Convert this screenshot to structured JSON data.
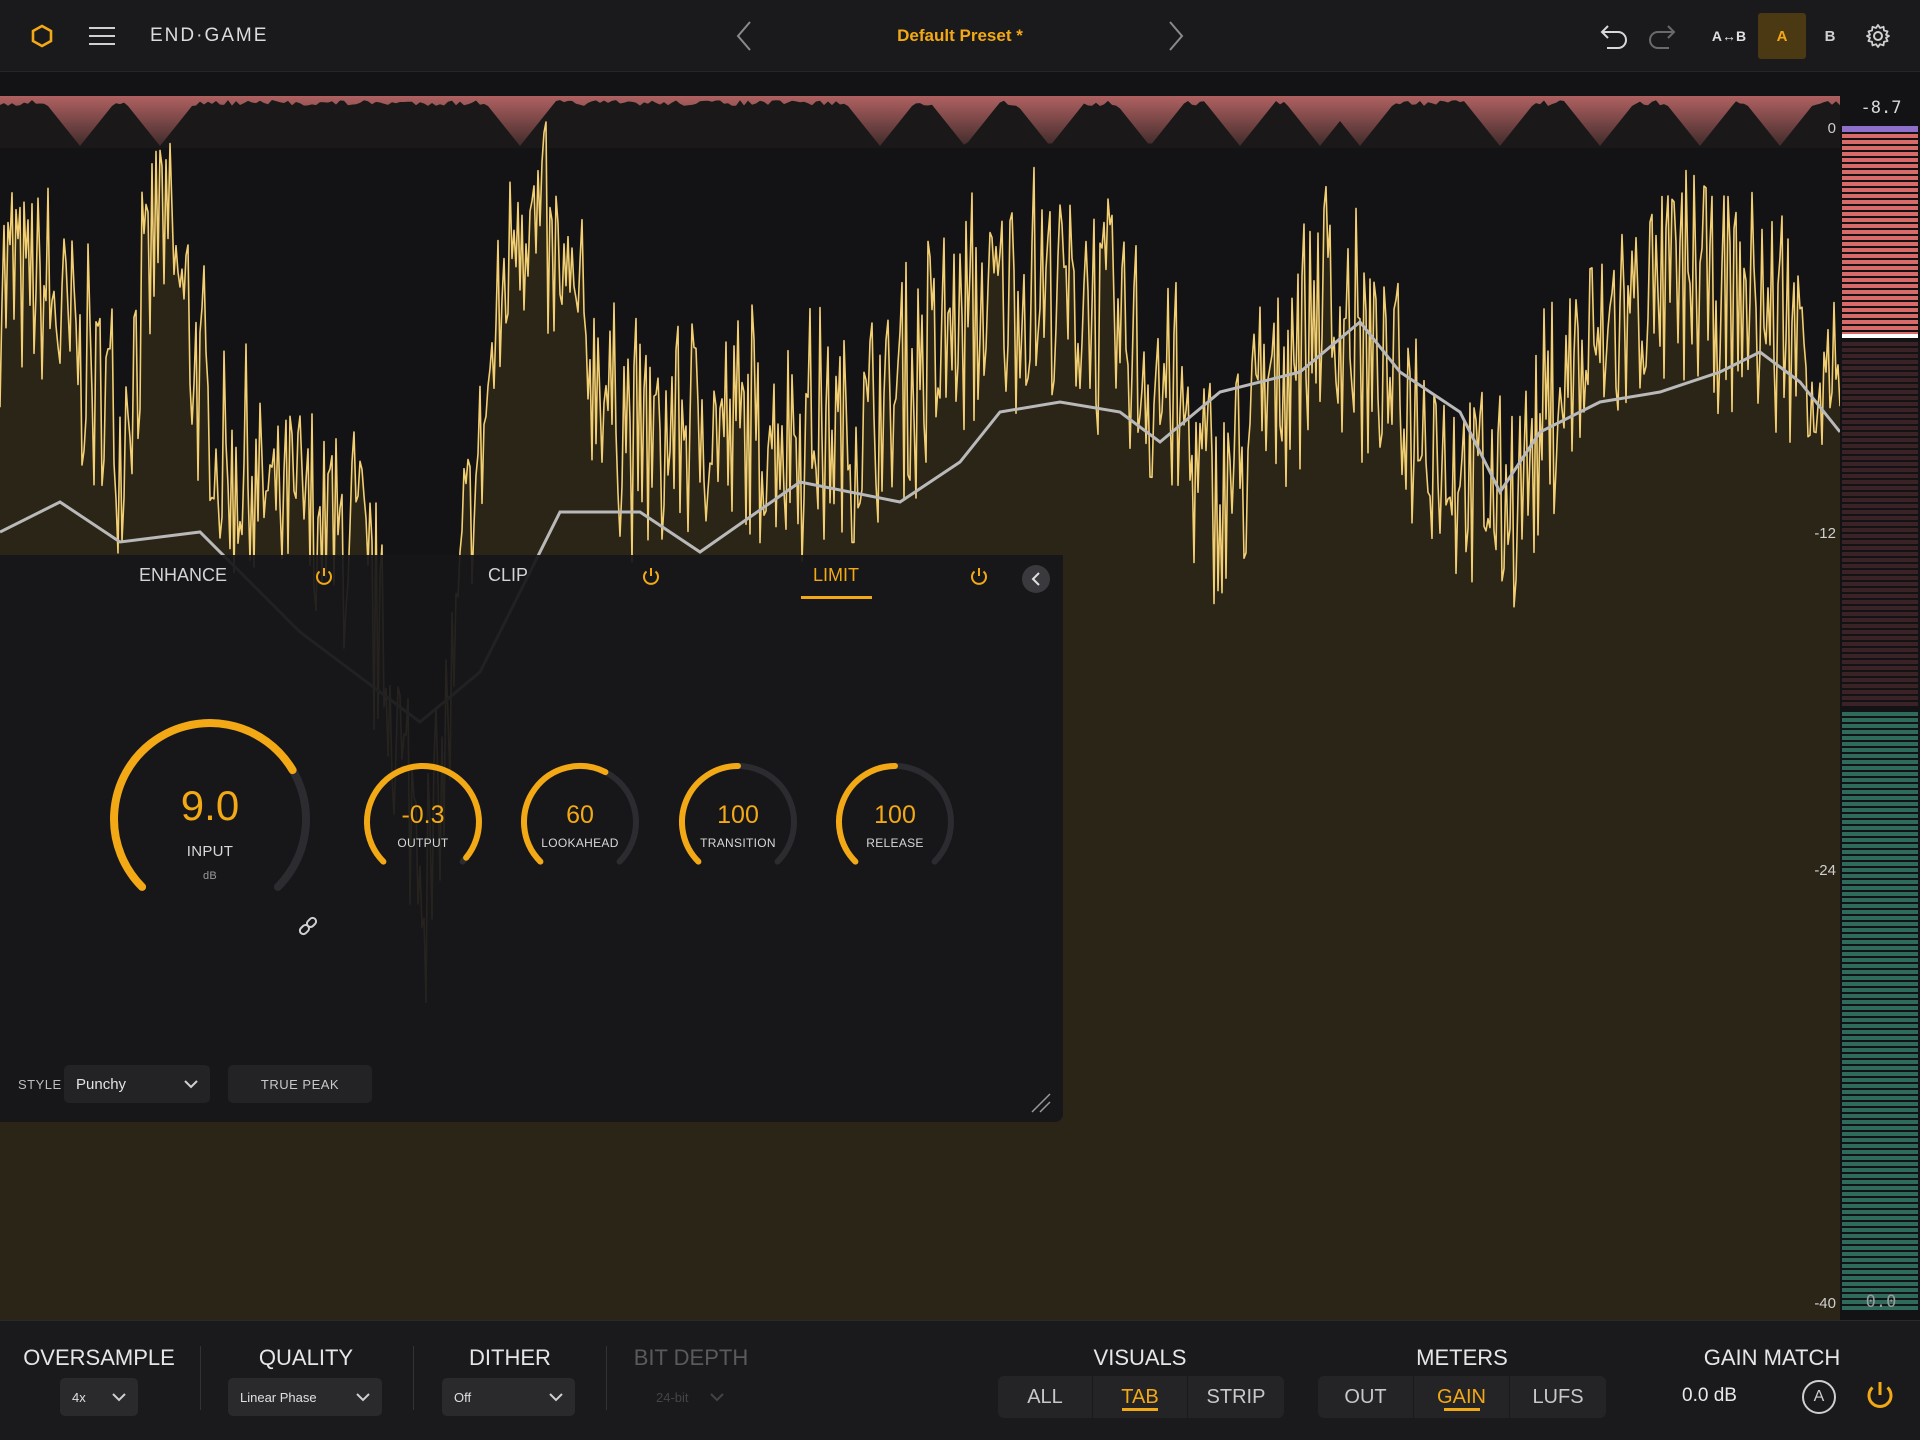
{
  "app": {
    "title": "END·GAME"
  },
  "header": {
    "preset": "Default Preset *",
    "ab_copy": "A↔B",
    "slot_a": "A",
    "slot_b": "B"
  },
  "icons": {
    "logo": "hexagon-icon",
    "menu": "hamburger-icon",
    "prev": "chevron-left-icon",
    "next": "chevron-right-icon",
    "undo": "undo-icon",
    "redo": "redo-icon",
    "settings": "gear-icon",
    "power": "power-icon",
    "link": "link-icon"
  },
  "colors": {
    "accent": "#f2a915",
    "waveform": "#f3cf72",
    "gain_reduction": "#c56a6a",
    "loudness": "#b9b9b9",
    "meter_red": "#d86a6a",
    "meter_green": "#2f6b5a"
  },
  "meter": {
    "peak": "-8.7",
    "bottom": "0.0",
    "scale": [
      "0",
      "-12",
      "-24",
      "-40"
    ],
    "level": 0.55,
    "threshold": 0.18
  },
  "panel": {
    "tabs": [
      {
        "label": "ENHANCE",
        "power": "on"
      },
      {
        "label": "CLIP",
        "power": "on"
      },
      {
        "label": "LIMIT",
        "power": "on",
        "selected": true
      }
    ],
    "knobs": {
      "input": {
        "value": "9.0",
        "label": "INPUT",
        "unit": "dB",
        "fill": 0.72
      },
      "output": {
        "value": "-0.3",
        "label": "OUTPUT",
        "fill": 0.98
      },
      "lookahead": {
        "value": "60",
        "label": "LOOKAHEAD",
        "fill": 0.6
      },
      "transition": {
        "value": "100",
        "label": "TRANSITION",
        "fill": 0.5
      },
      "release": {
        "value": "100",
        "label": "RELEASE",
        "fill": 0.5
      }
    },
    "style_label": "STYLE",
    "style_value": "Punchy",
    "true_peak": "TRUE PEAK"
  },
  "bottom": {
    "oversample": {
      "label": "OVERSAMPLE",
      "value": "4x"
    },
    "quality": {
      "label": "QUALITY",
      "value": "Linear Phase"
    },
    "dither": {
      "label": "DITHER",
      "value": "Off"
    },
    "bit_depth": {
      "label": "BIT DEPTH",
      "value": "24-bit",
      "disabled": true
    },
    "visuals": {
      "label": "VISUALS",
      "options": [
        "ALL",
        "TAB",
        "STRIP"
      ],
      "selected": "TAB"
    },
    "meters": {
      "label": "METERS",
      "options": [
        "OUT",
        "GAIN",
        "LUFS"
      ],
      "selected": "GAIN"
    },
    "gain_match": {
      "label": "GAIN MATCH",
      "value": "0.0 dB",
      "auto": "A"
    }
  }
}
